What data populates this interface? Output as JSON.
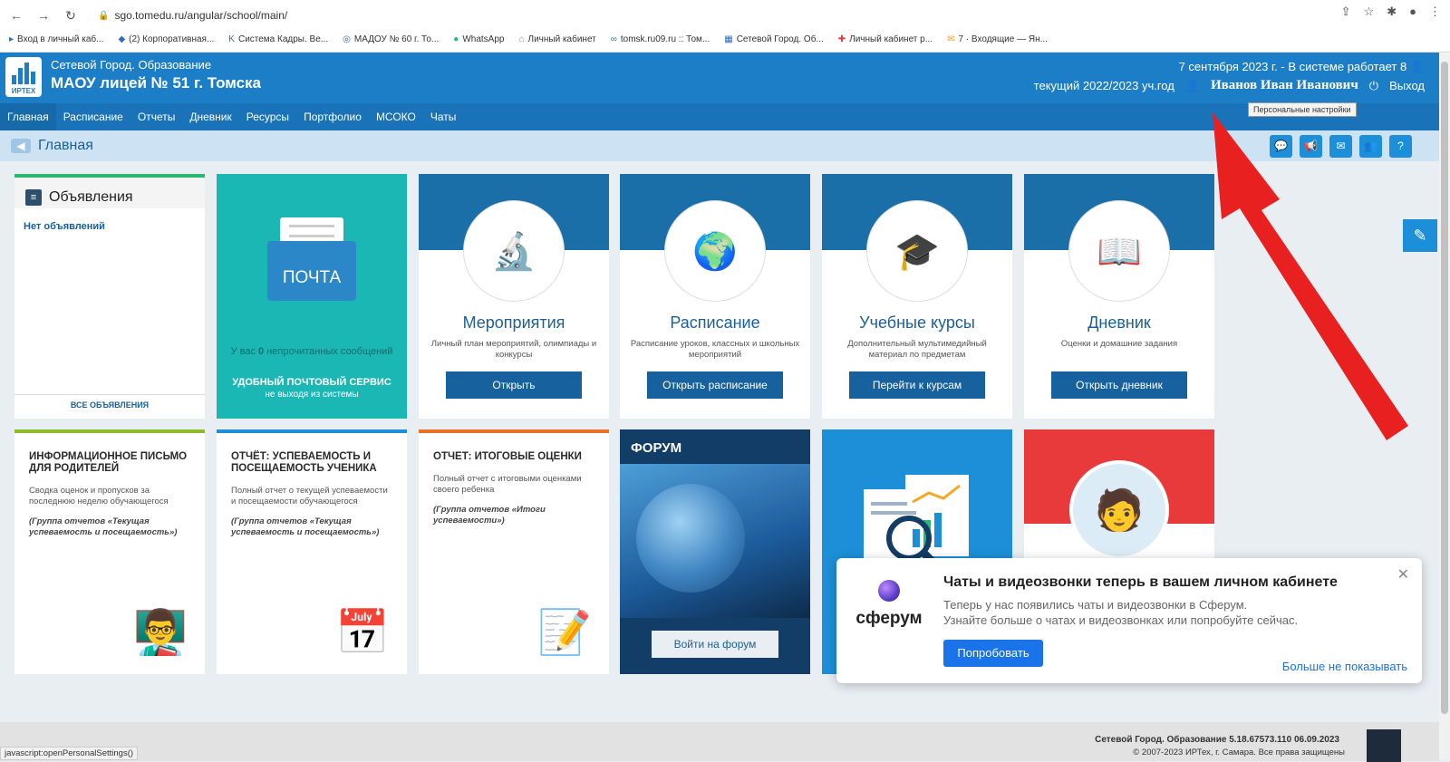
{
  "browser": {
    "url": "sgo.tomedu.ru/angular/school/main/",
    "nav": [
      "←",
      "→",
      "↻"
    ],
    "bookmarks": [
      "Вход в личный каб...",
      "(2) Корпоративная...",
      "Система Кадры. Ве...",
      "МАДОУ № 60 г. То...",
      "WhatsApp",
      "Личный кабинет",
      "tomsk.ru09.ru :: Том...",
      "Сетевой Город. Об...",
      "Личный кабинет р...",
      "7 · Входящие — Ян..."
    ]
  },
  "header": {
    "logo_text": "ИРТЕХ",
    "brand": "Сетевой Город. Образование",
    "school": "МАОУ лицей № 51 г. Томска",
    "date_line": "7 сентября 2023 г. - В системе работает 8",
    "year": "текущий 2022/2023 уч.год",
    "user": "Иванов Иван Иванович",
    "logout": "Выход",
    "tooltip": "Персональные настройки"
  },
  "menu": [
    "Главная",
    "Расписание",
    "Отчеты",
    "Дневник",
    "Ресурсы",
    "Портфолио",
    "МСОКО",
    "Чаты"
  ],
  "breadcrumb": {
    "title": "Главная",
    "tools": [
      "💬",
      "📢",
      "✉",
      "👥",
      "?"
    ]
  },
  "announcements": {
    "title": "Объявления",
    "empty": "Нет объявлений",
    "all": "ВСЕ ОБЪЯВЛЕНИЯ"
  },
  "mail": {
    "label": "ПОЧТА",
    "count_prefix": "У вас",
    "count": "0",
    "count_suffix": "непрочитанных сообщений",
    "service": "УДОБНЫЙ ПОЧТОВЫЙ СЕРВИС",
    "service_sub": "не выходя из системы"
  },
  "tiles": [
    {
      "title": "Мероприятия",
      "desc": "Личный план мероприятий, олимпиады и конкурсы",
      "button": "Открыть",
      "icon": "🔬"
    },
    {
      "title": "Расписание",
      "desc": "Расписание уроков, классных и школьных мероприятий",
      "button": "Открыть расписание",
      "icon": "🌍"
    },
    {
      "title": "Учебные курсы",
      "desc": "Дополнительный мультимедийный материал по предметам",
      "button": "Перейти к курсам",
      "icon": "🎓"
    },
    {
      "title": "Дневник",
      "desc": "Оценки и домашние задания",
      "button": "Открыть дневник",
      "icon": "📖"
    }
  ],
  "reports": [
    {
      "title": "ИНФОРМАЦИОННОЕ ПИСЬМО ДЛЯ РОДИТЕЛЕЙ",
      "desc": "Сводка оценок и пропусков за последнюю неделю обучающегося",
      "group": "(Группа отчетов «Текущая успеваемость и посещаемость»)",
      "icon": "👨‍🏫",
      "color": "#8bbd2b"
    },
    {
      "title": "ОТЧЁТ: УСПЕВАЕМОСТЬ И ПОСЕЩАЕМОСТЬ УЧЕНИКА",
      "desc": "Полный отчет о текущей успеваемости и посещаемости обучающегося",
      "group": "(Группа отчетов «Текущая успеваемость и посещаемость»)",
      "icon": "📅",
      "color": "#1d8fd8"
    },
    {
      "title": "ОТЧЕТ: ИТОГОВЫЕ ОЦЕНКИ",
      "desc": "Полный отчет с итоговыми оценками своего ребенка",
      "group": "(Группа отчетов «Итоги успеваемости»)",
      "icon": "📝",
      "color": "#e8702a"
    }
  ],
  "forum": {
    "title": "ФОРУМ",
    "button": "Войти на форум"
  },
  "popup": {
    "brand": "сферум",
    "title": "Чаты и видеозвонки теперь в вашем личном кабинете",
    "line1": "Теперь у нас появились чаты и видеозвонки в Сферум.",
    "line2": "Узнайте больше о чатах и видеозвонках или попробуйте сейчас.",
    "try": "Попробовать",
    "never": "Больше не показывать"
  },
  "footer": {
    "version": "Сетевой Город. Образование  5.18.67573.110  06.09.2023",
    "copyright": "© 2007-2023 ИРТех, г. Самара. Все права защищены"
  },
  "status": "javascript:openPersonalSettings()"
}
